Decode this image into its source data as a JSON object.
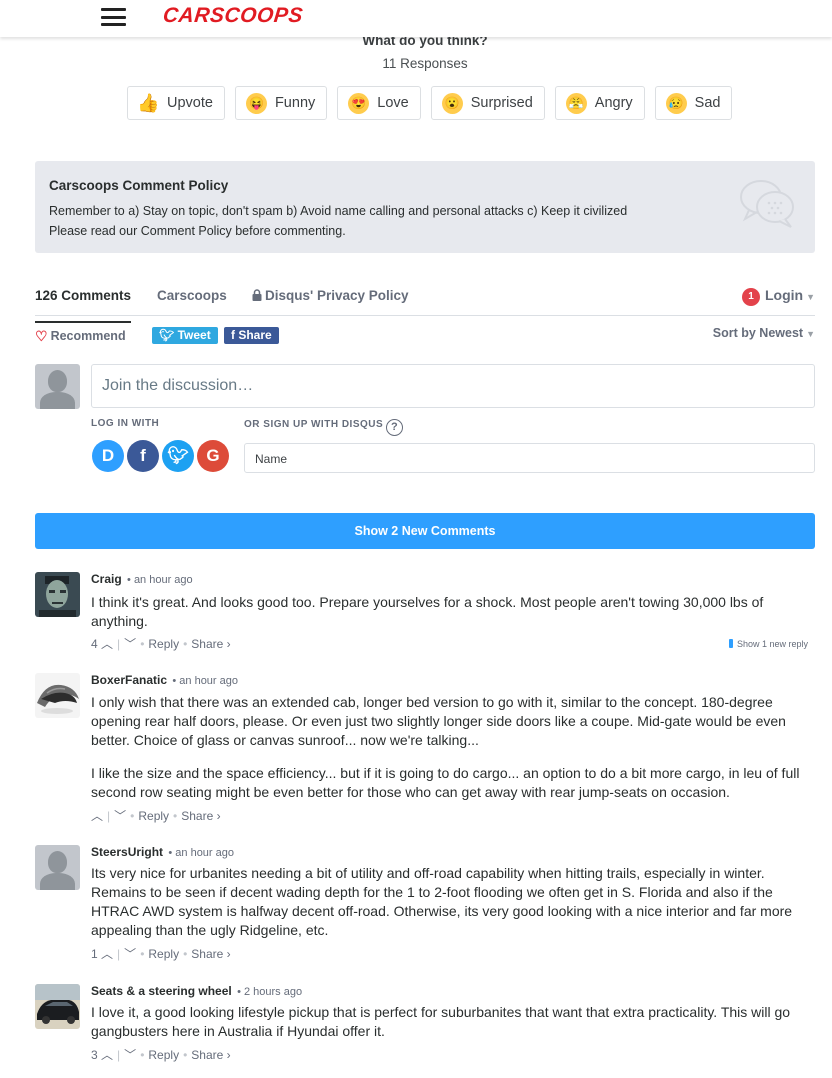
{
  "header": {
    "logo": "CARSCOOPS"
  },
  "reactions": {
    "question": "What do you think?",
    "responses": "11 Responses",
    "items": [
      {
        "label": "Upvote",
        "icon": "thumbs-up-icon"
      },
      {
        "label": "Funny",
        "icon": "funny-face-icon"
      },
      {
        "label": "Love",
        "icon": "heart-eyes-icon"
      },
      {
        "label": "Surprised",
        "icon": "surprised-face-icon"
      },
      {
        "label": "Angry",
        "icon": "angry-face-icon"
      },
      {
        "label": "Sad",
        "icon": "sad-face-icon"
      }
    ]
  },
  "policy": {
    "title": "Carscoops Comment Policy",
    "line1": "Remember to a) Stay on topic, don't spam b) Avoid name calling and personal attacks c) Keep it civilized",
    "line2_pre": "Please read our ",
    "line2_link": "Comment Policy",
    "line2_post": " before commenting."
  },
  "tabs": {
    "comments": "126 Comments",
    "site": "Carscoops",
    "privacy": "Disqus' Privacy Policy",
    "login_badge": "1",
    "login": "Login"
  },
  "actions": {
    "recommend": "Recommend",
    "tweet": "Tweet",
    "share": "Share",
    "sort": "Sort by Newest"
  },
  "compose": {
    "placeholder": "Join the discussion…",
    "login_with": "LOG IN WITH",
    "signup": "OR SIGN UP WITH DISQUS",
    "name_placeholder": "Name"
  },
  "show_new": "Show 2 New Comments",
  "comments": [
    {
      "author": "Craig",
      "time": "• an hour ago",
      "paragraphs": [
        "I think it's great. And looks good too. Prepare yourselves for a shock. Most people aren't towing 30,000 lbs of anything."
      ],
      "votes": "4",
      "reply": "Reply",
      "share": "Share ›",
      "new_reply": "Show 1 new reply"
    },
    {
      "author": "BoxerFanatic",
      "time": "• an hour ago",
      "paragraphs": [
        "I only wish that there was an extended cab, longer bed version to go with it, similar to the concept. 180-degree opening rear half doors, please. Or even just two slightly longer side doors like a coupe. Mid-gate would be even better. Choice of glass or canvas sunroof... now we're talking...",
        "I like the size and the space efficiency... but if it is going to do cargo... an option to do a bit more cargo, in leu of full second row seating might be even better for those who can get away with rear jump-seats on occasion."
      ],
      "votes": "",
      "reply": "Reply",
      "share": "Share ›"
    },
    {
      "author": "SteersUright",
      "time": "• an hour ago",
      "paragraphs": [
        "Its very nice for urbanites needing a bit of utility and off-road capability when hitting trails, especially in winter. Remains to be seen if decent wading depth for the 1 to 2-foot flooding we often get in S. Florida and also if the HTRAC AWD system is halfway decent off-road. Otherwise, its very good looking with a nice interior and far more appealing than the ugly Ridgeline, etc."
      ],
      "votes": "1",
      "reply": "Reply",
      "share": "Share ›"
    },
    {
      "author": "Seats & a steering wheel",
      "time": "• 2 hours ago",
      "paragraphs": [
        "I love it, a good looking lifestyle pickup that is perfect for suburbanites that want that extra practicality. This will go gangbusters here in Australia if Hyundai offer it."
      ],
      "votes": "3",
      "reply": "Reply",
      "share": "Share ›"
    }
  ],
  "colors": {
    "brand": "#e11b22",
    "disqus_blue": "#2e9fff",
    "twitter": "#2fa8e0",
    "facebook": "#3b5998",
    "google": "#dd4b39",
    "badge": "#e3424b"
  }
}
